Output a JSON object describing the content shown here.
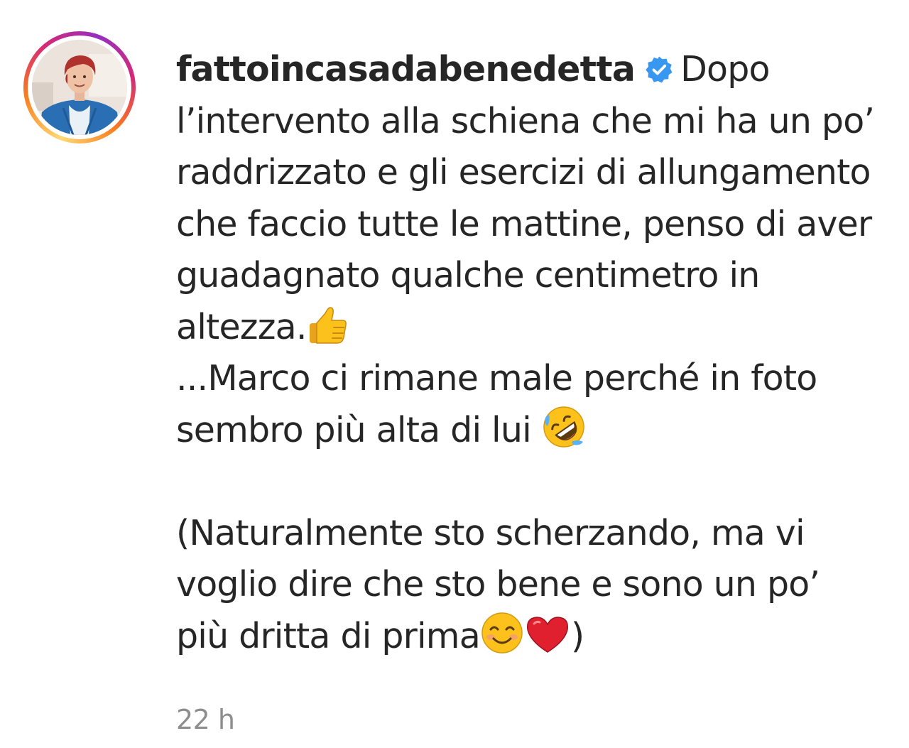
{
  "post": {
    "username": "fattoincasadabenedetta",
    "verified_icon": "verified-badge-icon",
    "caption": {
      "line1_tail": "Dopo",
      "line2": "l’intervento alla schiena che mi ha un po’",
      "line3": "raddrizzato e gli esercizi di allungamento",
      "line4": "che faccio tutte le mattine, penso di aver",
      "line5": "guadagnato qualche centimetro in",
      "line6": "altezza.",
      "line7": "...Marco ci rimane male perché in foto",
      "line8": "sembro più alta di lui ",
      "line10": "(Naturalmente sto scherzando, ma vi",
      "line11": "voglio dire che sto bene e sono un po’",
      "line12": "più dritta di prima",
      "line12_end": ")"
    },
    "emojis": [
      "thumbs-up-icon",
      "rolling-on-floor-laughing-icon",
      "smiling-face-icon",
      "red-heart-icon"
    ],
    "timestamp": "22 h"
  },
  "colors": {
    "text": "#262626",
    "muted": "#8e8e8e",
    "verified": "#3897f0"
  }
}
